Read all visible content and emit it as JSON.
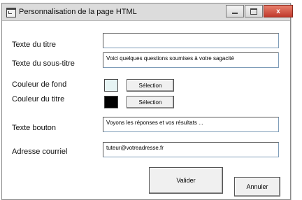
{
  "window": {
    "title": "Personnalisation de la page HTML",
    "minimize_icon": "minimize-icon",
    "maximize_icon": "maximize-icon",
    "close_icon": "close-icon",
    "close_label": "x"
  },
  "form": {
    "title_label": "Texte du titre",
    "title_value": "",
    "subtitle_label": "Texte du sous-titre",
    "subtitle_value": "Voici quelques questions soumises à votre sagacité",
    "bg_color_label": "Couleur de fond",
    "bg_color": "#e6f4f4",
    "title_color_label": "Couleur du titre",
    "title_color": "#000000",
    "select_label": "Sélection",
    "button_text_label": "Texte bouton",
    "button_text_value": "Voyons les réponses et vos résultats ...",
    "email_label": "Adresse courriel",
    "email_value": "tuteur@votreadresse.fr"
  },
  "actions": {
    "validate_label": "Valider",
    "cancel_label": "Annuler"
  },
  "overlay": {
    "cursor_icon": "mouse-pointer-icon"
  }
}
